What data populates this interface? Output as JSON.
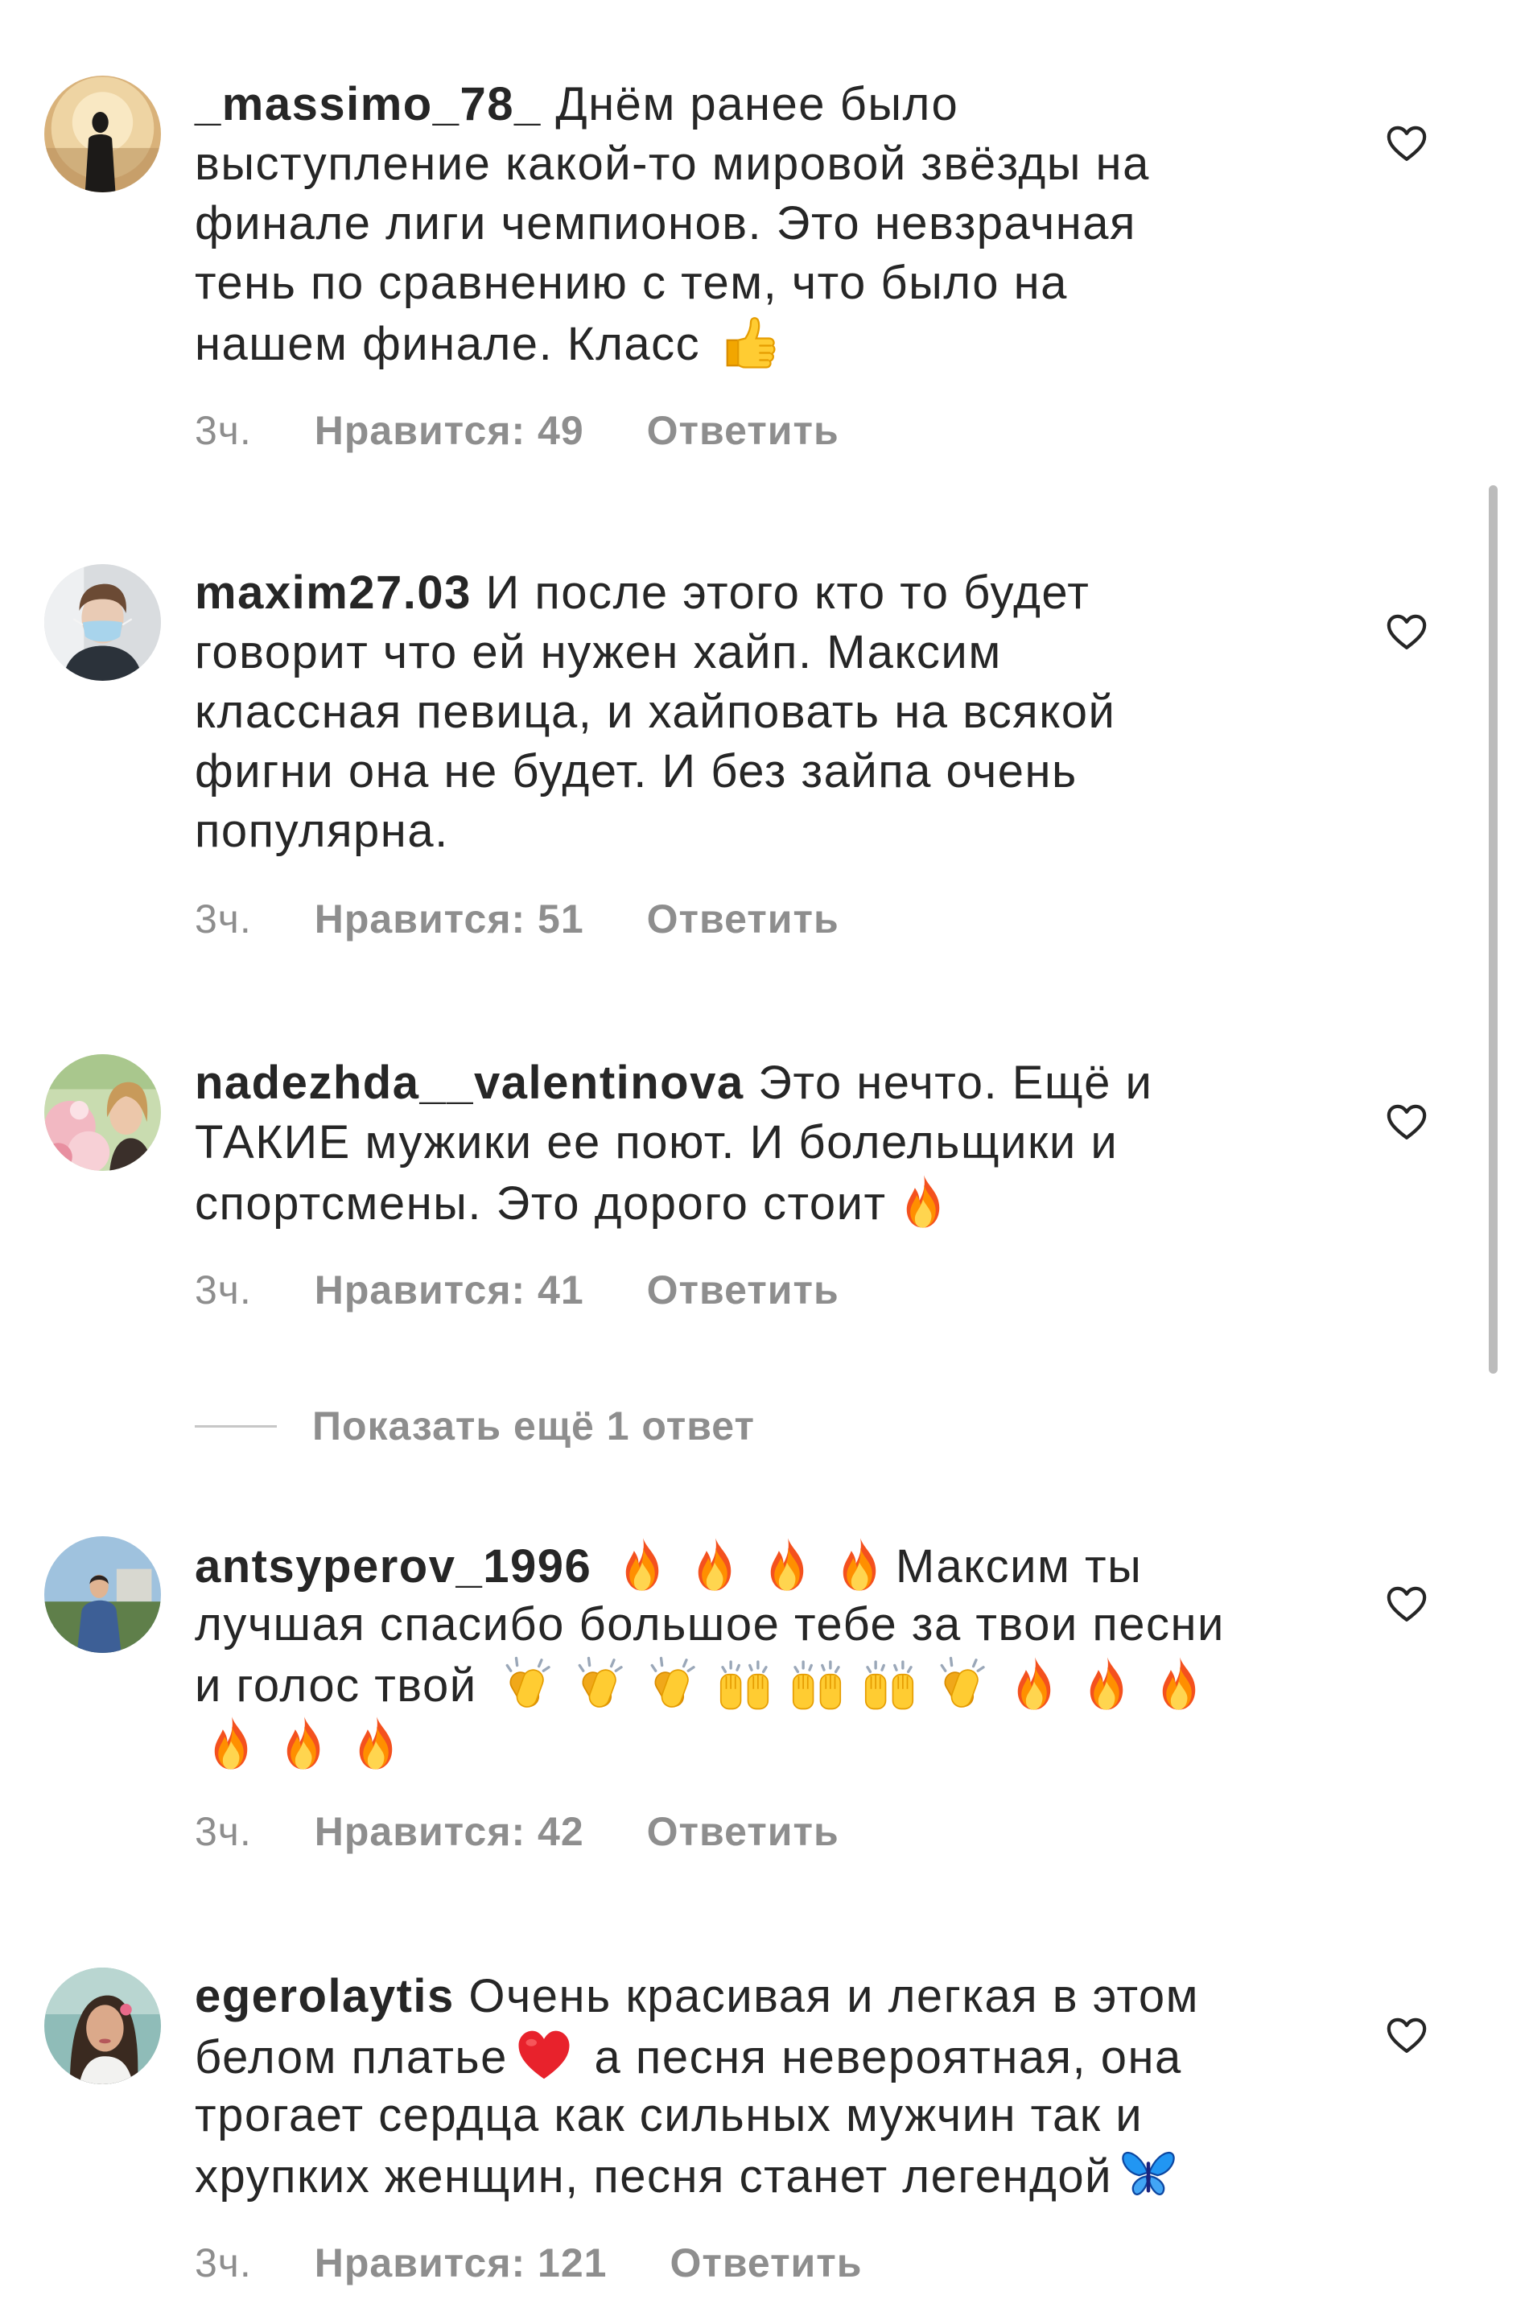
{
  "comments": [
    {
      "username": "_massimo_78_",
      "lines": [
        [
          {
            "t": "Днём ранее было"
          }
        ],
        [
          {
            "t": "выступление какой-то мировой звёзды на"
          }
        ],
        [
          {
            "t": "финале лиги чемпионов. Это невзрачная"
          }
        ],
        [
          {
            "t": "тень по сравнению с тем, что было на"
          }
        ],
        [
          {
            "t": "нашем финале. Класс "
          },
          {
            "e": "thumbs-up"
          }
        ]
      ],
      "time": "3ч.",
      "likes": "Нравится: 49",
      "reply": "Ответить"
    },
    {
      "username": "maxim27.03",
      "lines": [
        [
          {
            "t": "И после этого кто то будет"
          }
        ],
        [
          {
            "t": "говорит что ей нужен хайп. Максим"
          }
        ],
        [
          {
            "t": "классная певица, и хайповать на всякой"
          }
        ],
        [
          {
            "t": "фигни она не будет. И без зайпа очень"
          }
        ],
        [
          {
            "t": "популярна."
          }
        ]
      ],
      "time": "3ч.",
      "likes": "Нравится: 51",
      "reply": "Ответить"
    },
    {
      "username": "nadezhda__valentinova",
      "lines": [
        [
          {
            "t": "Это нечто. Ещё и"
          }
        ],
        [
          {
            "t": "ТАКИЕ мужики ее поют. И болельщики и"
          }
        ],
        [
          {
            "t": "спортсмены. Это дорого стоит"
          },
          {
            "e": "fire"
          }
        ]
      ],
      "time": "3ч.",
      "likes": "Нравится: 41",
      "reply": "Ответить"
    },
    {
      "username": "antsyperov_1996",
      "lines": [
        [
          {
            "e": "fire"
          },
          {
            "e": "fire"
          },
          {
            "e": "fire"
          },
          {
            "e": "fire"
          },
          {
            "t": "Максим ты"
          }
        ],
        [
          {
            "t": "лучшая спасибо большое тебе за твои песни"
          }
        ],
        [
          {
            "t": "и голос твой "
          },
          {
            "e": "clapping-hands"
          },
          {
            "e": "clapping-hands"
          },
          {
            "e": "clapping-hands"
          },
          {
            "e": "raised-hands"
          },
          {
            "e": "raised-hands"
          },
          {
            "e": "raised-hands"
          },
          {
            "e": "clapping-hands"
          },
          {
            "e": "fire"
          },
          {
            "e": "fire"
          },
          {
            "e": "fire"
          }
        ],
        [
          {
            "e": "fire"
          },
          {
            "e": "fire"
          },
          {
            "e": "fire"
          }
        ]
      ],
      "time": "3ч.",
      "likes": "Нравится: 42",
      "reply": "Ответить"
    },
    {
      "username": "egerolaytis",
      "lines": [
        [
          {
            "t": "Очень красивая и легкая в этом"
          }
        ],
        [
          {
            "t": "белом платье"
          },
          {
            "e": "red-heart"
          },
          {
            "t": " а песня невероятная, она"
          }
        ],
        [
          {
            "t": "трогает сердца как сильных мужчин так и"
          }
        ],
        [
          {
            "t": "хрупких женщин, песня станет легендой"
          },
          {
            "e": "butterfly"
          }
        ]
      ],
      "time": "3ч.",
      "likes": "Нравится: 121",
      "reply": "Ответить"
    }
  ],
  "show_more_replies": "Показать ещё 1 ответ",
  "colors": {
    "text": "#262626",
    "secondary": "#8e8e8e"
  }
}
